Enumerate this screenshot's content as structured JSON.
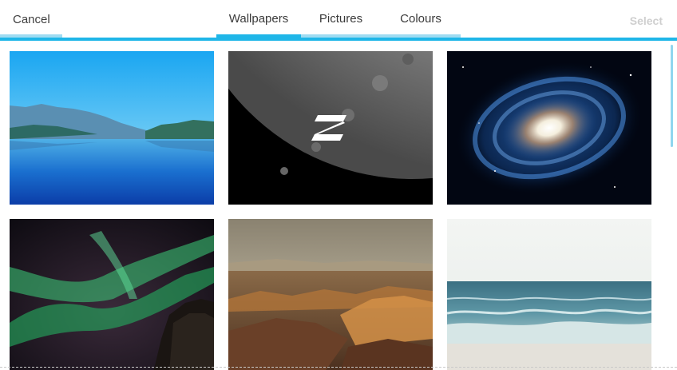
{
  "header": {
    "cancel_label": "Cancel",
    "select_label": "Select",
    "tabs": [
      {
        "label": "Wallpapers",
        "active": true
      },
      {
        "label": "Pictures",
        "active": false
      },
      {
        "label": "Colours",
        "active": false
      }
    ]
  },
  "accent_color": "#1fb6e8",
  "wallpapers": [
    {
      "subject": "lake-mountains"
    },
    {
      "subject": "moon-logo"
    },
    {
      "subject": "galaxy"
    },
    {
      "subject": "aurora"
    },
    {
      "subject": "canyon"
    },
    {
      "subject": "sea-waves"
    }
  ]
}
